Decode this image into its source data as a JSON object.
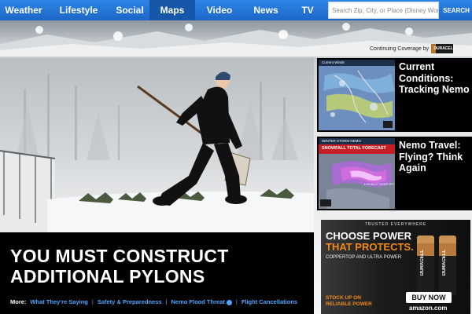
{
  "nav": {
    "items": [
      {
        "label": "Weather"
      },
      {
        "label": "Lifestyle"
      },
      {
        "label": "Social"
      },
      {
        "label": "Maps"
      },
      {
        "label": "Video"
      },
      {
        "label": "News"
      },
      {
        "label": "TV"
      }
    ],
    "active_index": 3,
    "search_placeholder": "Search Zip, City, or Place (Disney World)",
    "search_button": "SEARCH"
  },
  "sponsor": {
    "text": "Continuing Coverage by",
    "brand": "DURACELL"
  },
  "hero": {
    "headline": "YOU MUST CONSTRUCT ADDITIONAL PYLONS",
    "more_label": "More:",
    "links": [
      {
        "label": "What They're Saying"
      },
      {
        "label": "Safety & Preparedness"
      },
      {
        "label": "Nemo Flood Threat"
      },
      {
        "label": "Flight Cancellations"
      }
    ]
  },
  "cards": [
    {
      "title": "Current Conditions: Tracking Nemo",
      "thumb_label": "Current Winds"
    },
    {
      "title": "Nemo Travel: Flying? Think Again",
      "thumb_label": "WINTER STORM NEMO",
      "thumb_banner": "SNOWFALL TOTAL FORECAST",
      "thumb_tag": "LOCALLY OVER 2FT"
    }
  ],
  "ad": {
    "top": "TRUSTED EVERYWHERE",
    "headline_1": "CHOOSE POWER",
    "headline_2": "THAT PROTECTS.",
    "sub": "COPPERTOP AND ULTRA POWER",
    "stock_1": "STOCK UP ON",
    "stock_2": "RELIABLE POWER",
    "buy": "BUY NOW",
    "retailer": "amazon.com",
    "battery_brand": "DURACELL"
  },
  "colors": {
    "nav_blue": "#1c66c7",
    "link_blue": "#4da6ff",
    "ad_orange": "#f08a1a"
  }
}
